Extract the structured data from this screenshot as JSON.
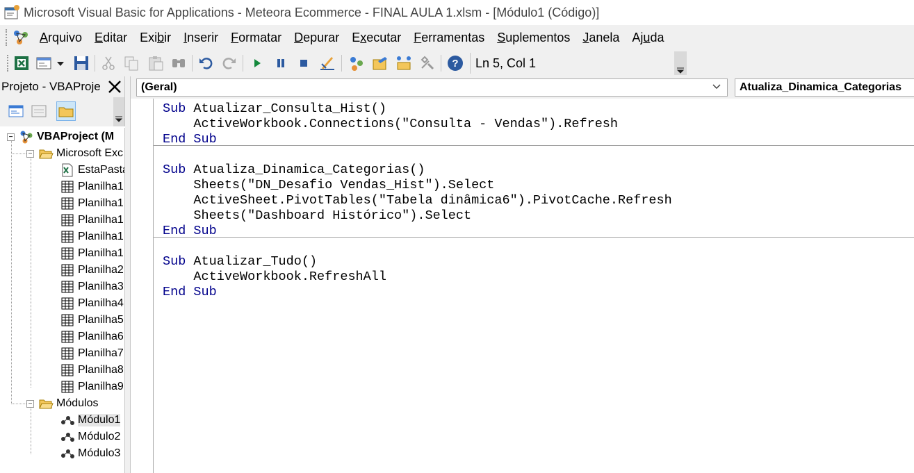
{
  "window": {
    "title": "Microsoft Visual Basic for Applications - Meteora Ecommerce - FINAL AULA 1.xlsm - [Módulo1 (Código)]"
  },
  "menu": {
    "items": [
      {
        "label_pre": "",
        "mnemonic": "A",
        "label_post": "rquivo"
      },
      {
        "label_pre": "",
        "mnemonic": "E",
        "label_post": "ditar"
      },
      {
        "label_pre": "Exi",
        "mnemonic": "b",
        "label_post": "ir"
      },
      {
        "label_pre": "",
        "mnemonic": "I",
        "label_post": "nserir"
      },
      {
        "label_pre": "",
        "mnemonic": "F",
        "label_post": "ormatar"
      },
      {
        "label_pre": "",
        "mnemonic": "D",
        "label_post": "epurar"
      },
      {
        "label_pre": "E",
        "mnemonic": "x",
        "label_post": "ecutar"
      },
      {
        "label_pre": "",
        "mnemonic": "F",
        "label_post": "erramentas"
      },
      {
        "label_pre": "",
        "mnemonic": "S",
        "label_post": "uplementos"
      },
      {
        "label_pre": "",
        "mnemonic": "J",
        "label_post": "anela"
      },
      {
        "label_pre": "Aj",
        "mnemonic": "u",
        "label_post": "da"
      }
    ]
  },
  "toolbar": {
    "position_text": "Ln 5, Col 1",
    "icons": [
      "excel-icon",
      "insert-userform-icon",
      "dropdown-arrow-icon",
      "save-icon",
      "cut-icon",
      "copy-icon",
      "paste-icon",
      "find-icon",
      "undo-icon",
      "redo-icon",
      "run-icon",
      "break-icon",
      "reset-icon",
      "design-mode-icon",
      "project-explorer-icon",
      "properties-icon",
      "object-browser-icon",
      "toolbox-icon",
      "help-icon"
    ]
  },
  "project": {
    "panel_title": "Projeto - VBAProje",
    "root": "VBAProject (M",
    "excel_folder": "Microsoft Exc",
    "excel_objects": [
      "EstaPasta",
      "Planilha1",
      "Planilha1",
      "Planilha1",
      "Planilha1",
      "Planilha1",
      "Planilha2",
      "Planilha3",
      "Planilha4",
      "Planilha5",
      "Planilha6",
      "Planilha7",
      "Planilha8",
      "Planilha9"
    ],
    "modules_folder": "Módulos",
    "modules": [
      "Módulo1",
      "Módulo2",
      "Módulo3"
    ]
  },
  "code": {
    "object_combo": "(Geral)",
    "procedure_combo": "Atualiza_Dinamica_Categorias",
    "lines": [
      {
        "kw": "Sub ",
        "rest": "Atualizar_Consulta_Hist()"
      },
      {
        "kw": "",
        "rest": "    ActiveWorkbook.Connections(\"Consulta - Vendas\").Refresh"
      },
      {
        "kw": "End Sub",
        "rest": ""
      },
      {
        "kw": "",
        "rest": ""
      },
      {
        "kw": "Sub ",
        "rest": "Atualiza_Dinamica_Categorias()"
      },
      {
        "kw": "",
        "rest": "    Sheets(\"DN_Desafio Vendas_Hist\").Select"
      },
      {
        "kw": "",
        "rest": "    ActiveSheet.PivotTables(\"Tabela dinâmica6\").PivotCache.Refresh"
      },
      {
        "kw": "",
        "rest": "    Sheets(\"Dashboard Histórico\").Select"
      },
      {
        "kw": "End Sub",
        "rest": ""
      },
      {
        "kw": "",
        "rest": ""
      },
      {
        "kw": "Sub ",
        "rest": "Atualizar_Tudo()"
      },
      {
        "kw": "",
        "rest": "    ActiveWorkbook.RefreshAll"
      },
      {
        "kw": "End Sub",
        "rest": ""
      }
    ]
  }
}
